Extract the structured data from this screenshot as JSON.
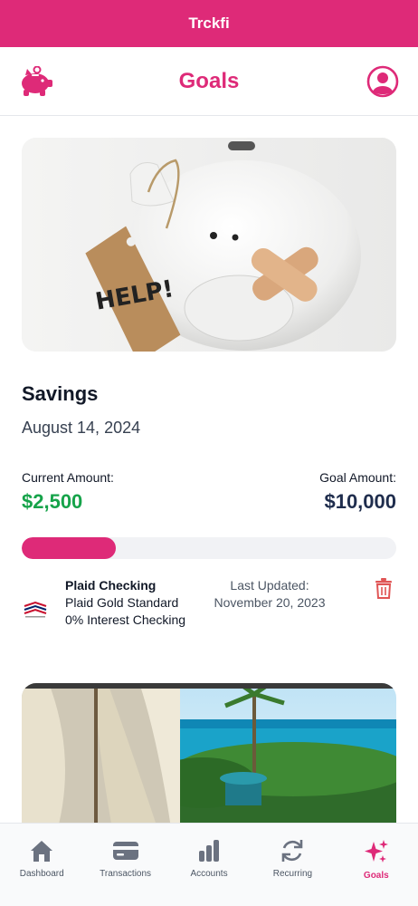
{
  "app": {
    "title": "Trckfi"
  },
  "header": {
    "title": "Goals",
    "left_icon": "piggy-bank-icon",
    "right_icon": "user-avatar-icon"
  },
  "goal": {
    "name": "Savings",
    "date": "August 14, 2024",
    "current_label": "Current Amount:",
    "current_value": "$2,500",
    "goal_label": "Goal Amount:",
    "goal_value": "$10,000",
    "progress_fraction": 0.25
  },
  "account": {
    "name": "Plaid Checking",
    "description": "Plaid Gold Standard 0% Interest Checking",
    "updated_label": "Last Updated:",
    "updated_date": "November 20, 2023",
    "logo": "bank-logo-icon"
  },
  "tabs": [
    {
      "label": "Dashboard",
      "icon": "home-icon",
      "active": false
    },
    {
      "label": "Transactions",
      "icon": "credit-card-icon",
      "active": false
    },
    {
      "label": "Accounts",
      "icon": "bar-chart-icon",
      "active": false
    },
    {
      "label": "Recurring",
      "icon": "refresh-icon",
      "active": false
    },
    {
      "label": "Goals",
      "icon": "sparkles-icon",
      "active": true
    }
  ],
  "colors": {
    "brand": "#de2a78",
    "positive": "#16a34a",
    "goal": "#1f2d4d",
    "delete": "#e05555"
  }
}
